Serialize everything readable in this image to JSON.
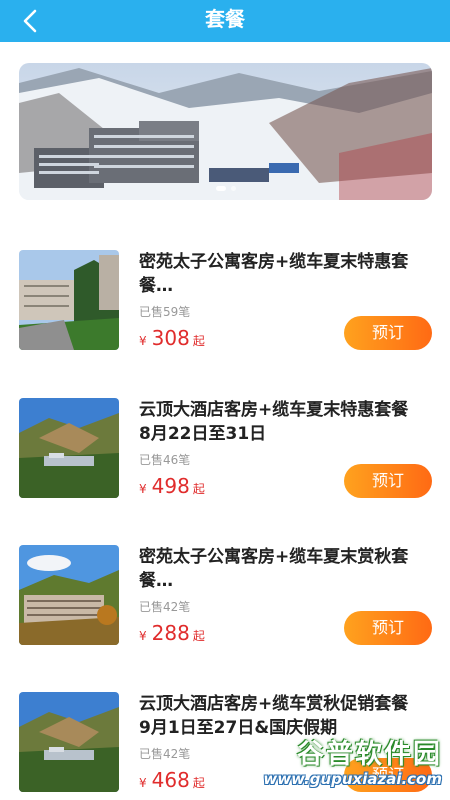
{
  "header": {
    "title": "套餐",
    "back_icon": "chevron-left-icon"
  },
  "banner": {
    "slide_count": 2,
    "active_slide": 1
  },
  "packages": [
    {
      "title": "密苑太子公寓客房+缆车夏末特惠套\n餐…",
      "sold": "已售59笔",
      "currency": "¥",
      "price": "308",
      "price_suffix": "起",
      "book_label": "预订"
    },
    {
      "title": "云顶大酒店客房+缆车夏末特惠套餐\n8月22日至31日",
      "sold": "已售46笔",
      "currency": "¥",
      "price": "498",
      "price_suffix": "起",
      "book_label": "预订"
    },
    {
      "title": "密苑太子公寓客房+缆车夏末赏秋套\n餐…",
      "sold": "已售42笔",
      "currency": "¥",
      "price": "288",
      "price_suffix": "起",
      "book_label": "预订"
    },
    {
      "title": "云顶大酒店客房+缆车赏秋促销套餐\n9月1日至27日&国庆假期",
      "sold": "已售42笔",
      "currency": "¥",
      "price": "468",
      "price_suffix": "起",
      "book_label": "预订"
    }
  ],
  "watermark": {
    "title": "谷普软件园",
    "url": "www.gupuxiazai.com"
  },
  "colors": {
    "header": "#2ab0ee",
    "price": "#e02c2c",
    "button_start": "#ffa21e",
    "button_end": "#ff6a14"
  }
}
